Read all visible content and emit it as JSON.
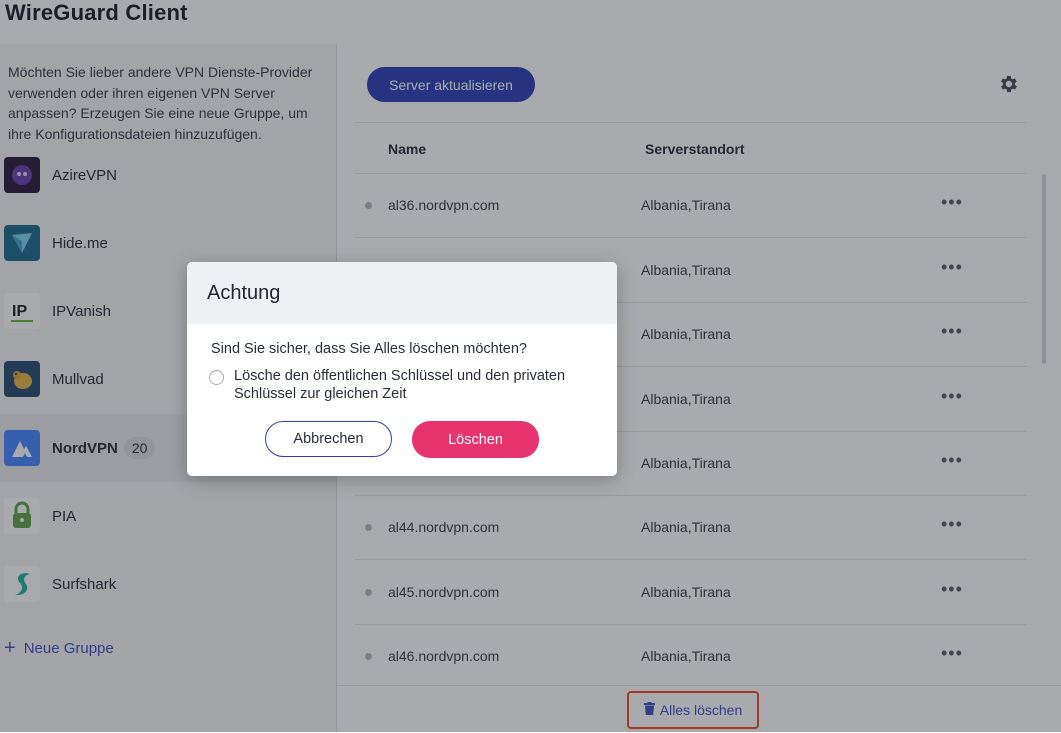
{
  "app": {
    "title": "WireGuard Client"
  },
  "sidebar": {
    "intro": "Möchten Sie lieber andere VPN Dienste-Provider verwenden oder ihren eigenen VPN Server anpassen? Erzeugen Sie eine neue Gruppe, um ihre Konfigurationsdateien hinzuzufügen.",
    "providers": [
      {
        "name": "AzireVPN",
        "icon": "azirevpn-logo-icon",
        "color": "#2a1a3e"
      },
      {
        "name": "Hide.me",
        "icon": "hideme-logo-icon",
        "color": "#1e6b8f"
      },
      {
        "name": "IPVanish",
        "icon": "ipvanish-logo-icon",
        "color": "#ffffff"
      },
      {
        "name": "Mullvad",
        "icon": "mullvad-logo-icon",
        "color": "#294d73"
      },
      {
        "name": "NordVPN",
        "icon": "nordvpn-logo-icon",
        "color": "#4687ff",
        "badge": "20",
        "active": true
      },
      {
        "name": "PIA",
        "icon": "pia-logo-icon",
        "color": "#5ea44a"
      },
      {
        "name": "Surfshark",
        "icon": "surfshark-logo-icon",
        "color": "#1eb6a4"
      }
    ],
    "new_group_label": "Neue Gruppe"
  },
  "main": {
    "update_button": "Server aktualisieren",
    "settings_icon": "gear-icon",
    "columns": {
      "name": "Name",
      "location": "Serverstandort"
    },
    "rows": [
      {
        "name": "al36.nordvpn.com",
        "location": "Albania,Tirana"
      },
      {
        "name": "",
        "location": "Albania,Tirana"
      },
      {
        "name": "",
        "location": "Albania,Tirana"
      },
      {
        "name": "",
        "location": "Albania,Tirana"
      },
      {
        "name": "",
        "location": "Albania,Tirana"
      },
      {
        "name": "al44.nordvpn.com",
        "location": "Albania,Tirana"
      },
      {
        "name": "al45.nordvpn.com",
        "location": "Albania,Tirana"
      },
      {
        "name": "al46.nordvpn.com",
        "location": "Albania,Tirana"
      }
    ],
    "more_label": "•••",
    "delete_all_label": "Alles löschen"
  },
  "dialog": {
    "title": "Achtung",
    "question": "Sind Sie sicher, dass Sie Alles löschen möchten?",
    "option_label": "Lösche den öffentlichen Schlüssel und den privaten Schlüssel zur gleichen Zeit",
    "cancel_label": "Abbrechen",
    "confirm_label": "Löschen"
  },
  "colors": {
    "accent": "#2d3fb7",
    "danger": "#e8346e",
    "highlight": "#f24b1f"
  }
}
